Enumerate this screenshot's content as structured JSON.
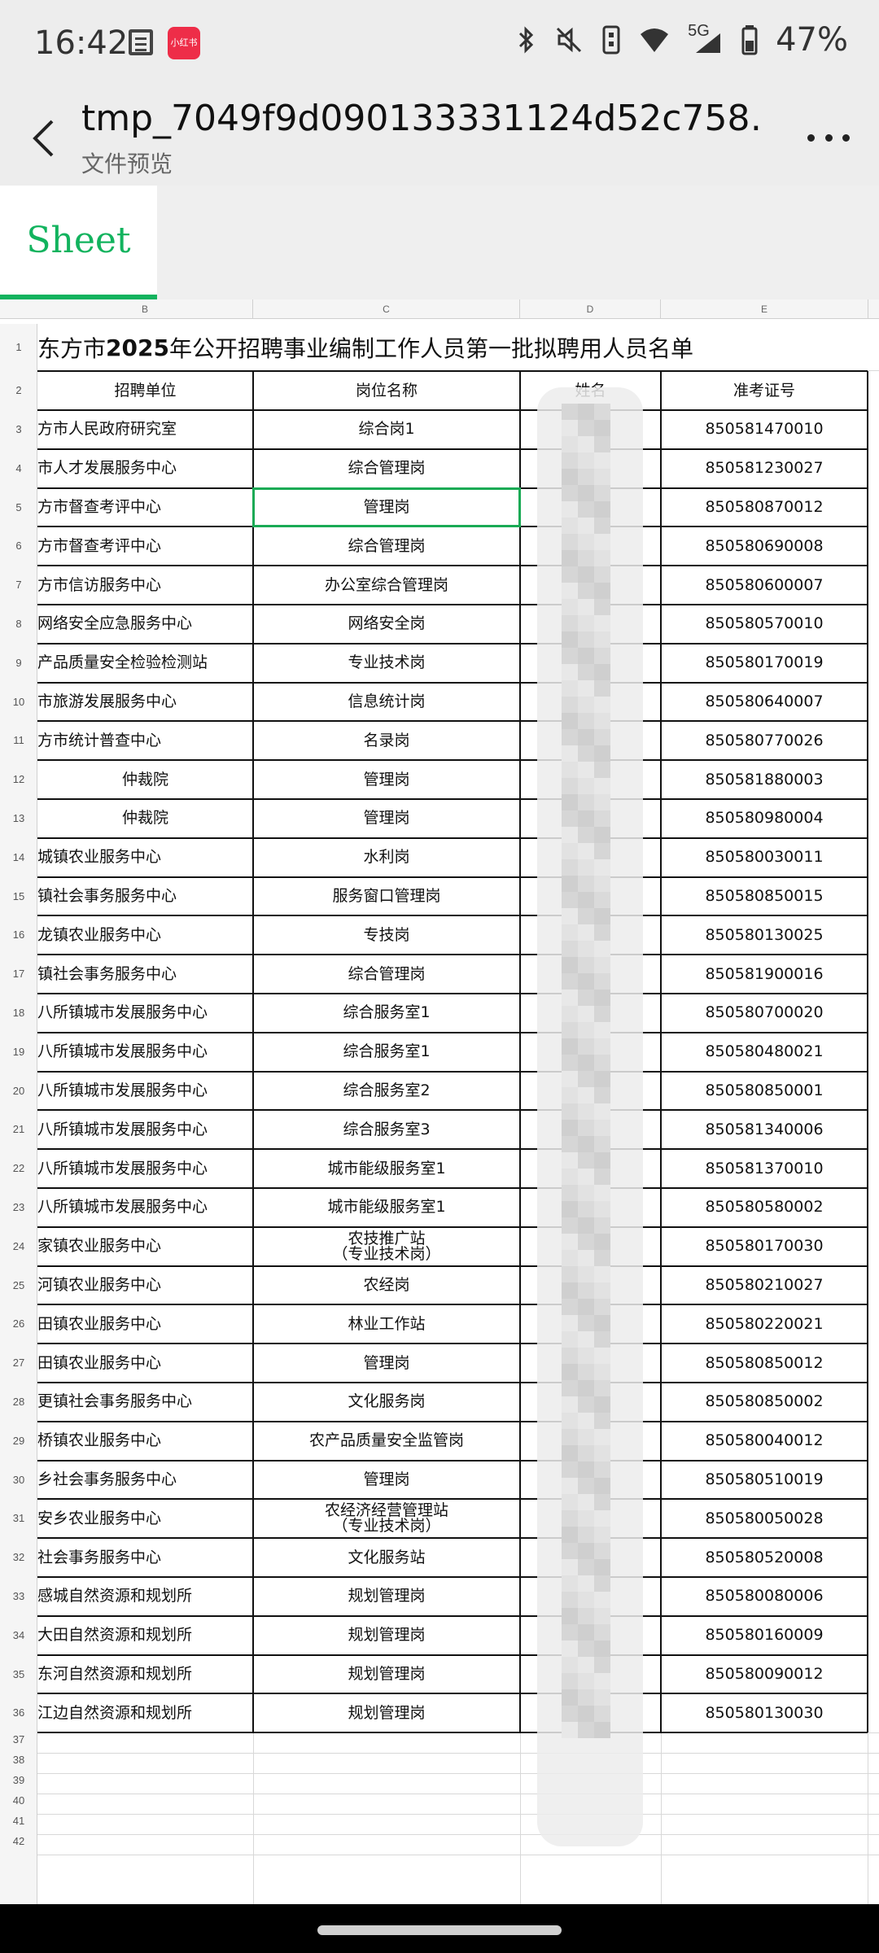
{
  "status_bar": {
    "time": "16:42",
    "app_badge": "小红书",
    "network": "5G",
    "battery": "47%"
  },
  "app_bar": {
    "title": "tmp_7049f9d090133331124d52c758…",
    "subtitle": "文件预览"
  },
  "sheet_tab": {
    "label": "Sheet"
  },
  "columns": [
    "B",
    "C",
    "D",
    "E"
  ],
  "sheet": {
    "title_prefix": "东方市",
    "title_year": "2025",
    "title_suffix": "年公开招聘事业编制工作人员第一批拟聘用人员名单",
    "headers": {
      "unit": "招聘单位",
      "post": "岗位名称",
      "name": "姓名",
      "exam_no": "准考证号"
    },
    "rows": [
      {
        "unit": "方市人民政府研究室",
        "post": "综合岗1",
        "exam_no": "850581470010"
      },
      {
        "unit": "市人才发展服务中心",
        "post": "综合管理岗",
        "exam_no": "850581230027"
      },
      {
        "unit": "方市督查考评中心",
        "post": "管理岗",
        "exam_no": "850580870012"
      },
      {
        "unit": "方市督查考评中心",
        "post": "综合管理岗",
        "exam_no": "850580690008"
      },
      {
        "unit": "方市信访服务中心",
        "post": "办公室综合管理岗",
        "exam_no": "850580600007"
      },
      {
        "unit": "网络安全应急服务中心",
        "post": "网络安全岗",
        "exam_no": "850580570010"
      },
      {
        "unit": "产品质量安全检验检测站",
        "post": "专业技术岗",
        "exam_no": "850580170019"
      },
      {
        "unit": "市旅游发展服务中心",
        "post": "信息统计岗",
        "exam_no": "850580640007"
      },
      {
        "unit": "方市统计普查中心",
        "post": "名录岗",
        "exam_no": "850580770026"
      },
      {
        "unit": "仲裁院",
        "post": "管理岗",
        "exam_no": "850581880003"
      },
      {
        "unit": "仲裁院",
        "post": "管理岗",
        "exam_no": "850580980004"
      },
      {
        "unit": "城镇农业服务中心",
        "post": "水利岗",
        "exam_no": "850580030011"
      },
      {
        "unit": "镇社会事务服务中心",
        "post": "服务窗口管理岗",
        "exam_no": "850580850015"
      },
      {
        "unit": "龙镇农业服务中心",
        "post": "专技岗",
        "exam_no": "850580130025"
      },
      {
        "unit": "镇社会事务服务中心",
        "post": "综合管理岗",
        "exam_no": "850581900016"
      },
      {
        "unit": "八所镇城市发展服务中心",
        "post": "综合服务室1",
        "exam_no": "850580700020"
      },
      {
        "unit": "八所镇城市发展服务中心",
        "post": "综合服务室1",
        "exam_no": "850580480021"
      },
      {
        "unit": "八所镇城市发展服务中心",
        "post": "综合服务室2",
        "exam_no": "850580850001"
      },
      {
        "unit": "八所镇城市发展服务中心",
        "post": "综合服务室3",
        "exam_no": "850581340006"
      },
      {
        "unit": "八所镇城市发展服务中心",
        "post": "城市能级服务室1",
        "exam_no": "850581370010"
      },
      {
        "unit": "八所镇城市发展服务中心",
        "post": "城市能级服务室1",
        "exam_no": "850580580002"
      },
      {
        "unit": "家镇农业服务中心",
        "post": "农技推广站",
        "post2": "（专业技术岗）",
        "exam_no": "850580170030"
      },
      {
        "unit": "河镇农业服务中心",
        "post": "农经岗",
        "exam_no": "850580210027"
      },
      {
        "unit": "田镇农业服务中心",
        "post": "林业工作站",
        "exam_no": "850580220021"
      },
      {
        "unit": "田镇农业服务中心",
        "post": "管理岗",
        "exam_no": "850580850012"
      },
      {
        "unit": "更镇社会事务服务中心",
        "post": "文化服务岗",
        "exam_no": "850580850002"
      },
      {
        "unit": "桥镇农业服务中心",
        "post": "农产品质量安全监管岗",
        "exam_no": "850580040012"
      },
      {
        "unit": "乡社会事务服务中心",
        "post": "管理岗",
        "exam_no": "850580510019"
      },
      {
        "unit": "安乡农业服务中心",
        "post": "农经济经营管理站",
        "post2": "（专业技术岗）",
        "exam_no": "850580050028"
      },
      {
        "unit": "社会事务服务中心",
        "post": "文化服务站",
        "exam_no": "850580520008"
      },
      {
        "unit": "感城自然资源和规划所",
        "post": "规划管理岗",
        "exam_no": "850580080006"
      },
      {
        "unit": "大田自然资源和规划所",
        "post": "规划管理岗",
        "exam_no": "850580160009"
      },
      {
        "unit": "东河自然资源和规划所",
        "post": "规划管理岗",
        "exam_no": "850580090012"
      },
      {
        "unit": "江边自然资源和规划所",
        "post": "规划管理岗",
        "exam_no": "850580130030"
      }
    ],
    "row_numbers": [
      "1",
      "2",
      "3",
      "4",
      "5",
      "6",
      "7",
      "8",
      "9",
      "10",
      "11",
      "12",
      "13",
      "14",
      "15",
      "16",
      "17",
      "18",
      "19",
      "20",
      "21",
      "22",
      "23",
      "24",
      "25",
      "26",
      "27",
      "28",
      "29",
      "30",
      "31",
      "32",
      "33",
      "34",
      "35",
      "36",
      "37",
      "38",
      "39",
      "40",
      "41",
      "42"
    ]
  },
  "colors": {
    "accent_green": "#12b35e",
    "selection_green": "#1aaa55",
    "header_bg": "#ededed"
  }
}
